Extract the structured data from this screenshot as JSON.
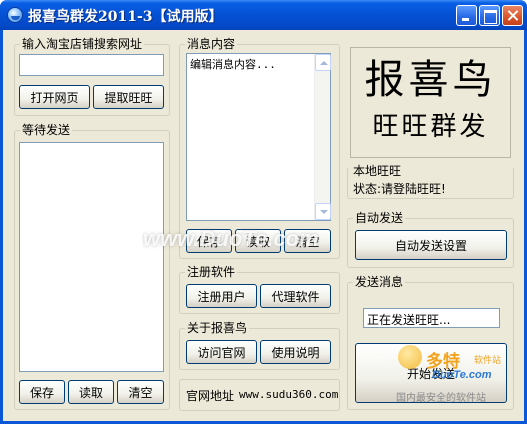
{
  "window": {
    "title": "报喜鸟群发2011-3【试用版】"
  },
  "url_group": {
    "legend": "输入淘宝店铺搜索网址",
    "input_value": "",
    "open_button": "打开网页",
    "extract_button": "提取旺旺"
  },
  "waiting_group": {
    "legend": "等待发送",
    "items": [],
    "save_button": "保存",
    "read_button": "读取",
    "clear_button": "清空"
  },
  "message_group": {
    "legend": "消息内容",
    "content": "编辑消息内容...",
    "save_button": "保存",
    "read_button": "读取",
    "clear_button": "清空"
  },
  "register_group": {
    "legend": "注册软件",
    "register_button": "注册用户",
    "agent_button": "代理软件"
  },
  "about_group": {
    "legend": "关于报喜鸟",
    "visit_button": "访问官网",
    "help_button": "使用说明"
  },
  "website": {
    "label": "官网地址",
    "url": "www.sudu360.com"
  },
  "brand": {
    "line1": "报喜鸟",
    "line2": "旺旺群发"
  },
  "local_wangwang": {
    "legend": "本地旺旺",
    "status": "状态:请登陆旺旺!"
  },
  "auto_send": {
    "legend": "自动发送",
    "settings_button": "自动发送设置"
  },
  "send_message": {
    "legend": "发送消息",
    "status_value": "正在发送旺旺...",
    "start_button": "开始发送"
  },
  "watermarks": {
    "center": "www.DuoTe.com",
    "corner_brand": "多特",
    "corner_tag": "软件站",
    "corner_url": "DuoTe.com",
    "corner_slogan": "国内最安全的软件站"
  }
}
